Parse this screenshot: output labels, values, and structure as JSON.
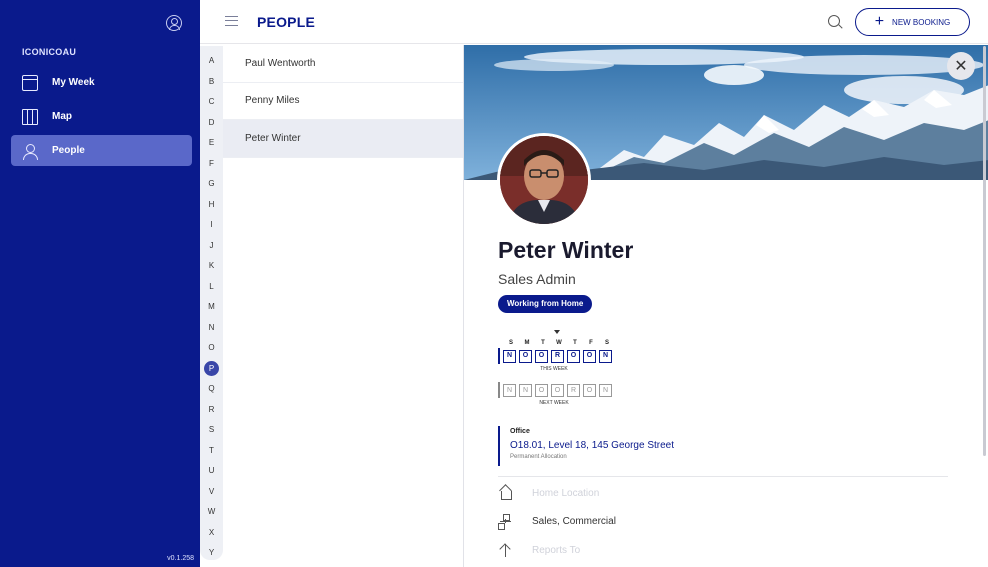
{
  "sidebar": {
    "org": "ICONICOAU",
    "items": [
      {
        "label": "My Week",
        "icon": "calendar-icon"
      },
      {
        "label": "Map",
        "icon": "map-icon"
      },
      {
        "label": "People",
        "icon": "people-icon"
      }
    ],
    "version": "v0.1.258"
  },
  "header": {
    "title": "PEOPLE",
    "new_booking_label": "NEW BOOKING",
    "new_booking_icon": "plus-icon"
  },
  "alphabet": [
    "A",
    "B",
    "C",
    "D",
    "E",
    "F",
    "G",
    "H",
    "I",
    "J",
    "K",
    "L",
    "M",
    "N",
    "O",
    "P",
    "Q",
    "R",
    "S",
    "T",
    "U",
    "V",
    "W",
    "X",
    "Y"
  ],
  "alphabet_active": "P",
  "people_list": [
    {
      "name": "Paul Wentworth",
      "selected": false
    },
    {
      "name": "Penny Miles",
      "selected": false
    },
    {
      "name": "Peter Winter",
      "selected": true
    }
  ],
  "profile": {
    "name": "Peter Winter",
    "role": "Sales Admin",
    "status": "Working from Home",
    "week_days": [
      "S",
      "M",
      "T",
      "W",
      "T",
      "F",
      "S"
    ],
    "this_week": [
      "N",
      "O",
      "O",
      "R",
      "O",
      "O",
      "N"
    ],
    "this_week_label": "THIS WEEK",
    "next_week": [
      "N",
      "N",
      "O",
      "O",
      "R",
      "O",
      "N"
    ],
    "next_week_label": "NEXT WEEK",
    "office_label": "Office",
    "office_address": "O18.01, Level 18, 145 George Street",
    "office_allocation": "Permanent Allocation",
    "home_location": "Home Location",
    "departments": "Sales,  Commercial",
    "reports_to": "Reports To"
  },
  "colors": {
    "brand": "#0a1a8c",
    "accent": "#5a68c9"
  }
}
